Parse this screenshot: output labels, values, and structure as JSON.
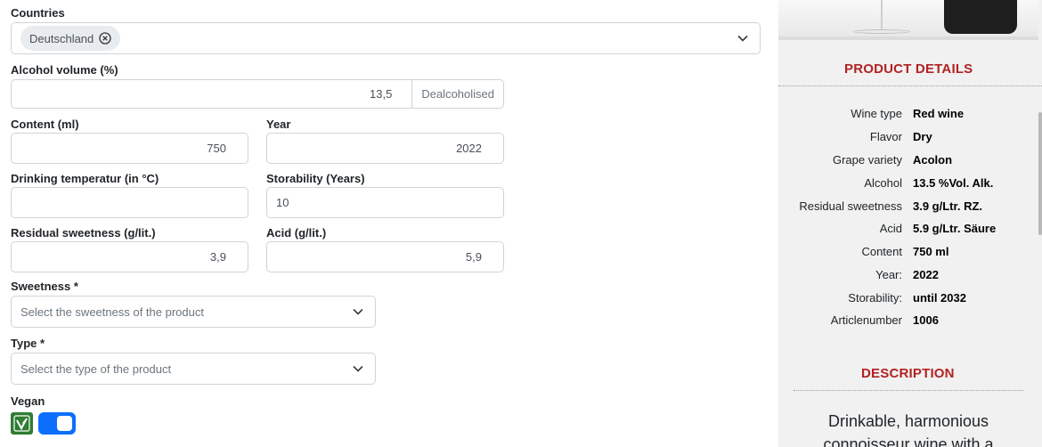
{
  "form": {
    "countries": {
      "label": "Countries",
      "chips": [
        "Deutschland"
      ]
    },
    "alcohol": {
      "label": "Alcohol volume (%)",
      "value": "13,5",
      "addon": "Dealcoholised"
    },
    "content": {
      "label": "Content (ml)",
      "value": "750"
    },
    "year": {
      "label": "Year",
      "value": "2022"
    },
    "drinking_temp": {
      "label": "Drinking temperatur (in °C)",
      "value": ""
    },
    "storability": {
      "label": "Storability (Years)",
      "value": "10"
    },
    "residual_sweetness": {
      "label": "Residual sweetness (g/lit.)",
      "value": "3,9"
    },
    "acid": {
      "label": "Acid (g/lit.)",
      "value": "5,9"
    },
    "sweetness": {
      "label": "Sweetness *",
      "placeholder": "Select the sweetness of the product"
    },
    "type": {
      "label": "Type *",
      "placeholder": "Select the type of the product"
    },
    "vegan": {
      "label": "Vegan",
      "enabled": true
    }
  },
  "panel": {
    "details_title": "PRODUCT DETAILS",
    "details": [
      {
        "key": "Wine type",
        "value": "Red wine"
      },
      {
        "key": "Flavor",
        "value": "Dry"
      },
      {
        "key": "Grape variety",
        "value": "Acolon"
      },
      {
        "key": "Alcohol",
        "value": "13.5 %Vol. Alk."
      },
      {
        "key": "Residual sweetness",
        "value": "3.9 g/Ltr. RZ."
      },
      {
        "key": "Acid",
        "value": "5.9 g/Ltr. Säure"
      },
      {
        "key": "Content",
        "value": "750 ml"
      },
      {
        "key": "Year:",
        "value": "2022"
      },
      {
        "key": "Storability:",
        "value": "until 2032"
      },
      {
        "key": "Articlenumber",
        "value": "1006"
      }
    ],
    "description_title": "DESCRIPTION",
    "description_lines": [
      "Drinkable, harmonious",
      "connoisseur wine with a"
    ]
  },
  "colors": {
    "accent": "#0d6efd",
    "heading_red": "#b22222",
    "vegan_green": "#2e7d32"
  },
  "icons": [
    "close-circle-icon",
    "chevron-down-icon",
    "vegan-leaf-icon"
  ]
}
